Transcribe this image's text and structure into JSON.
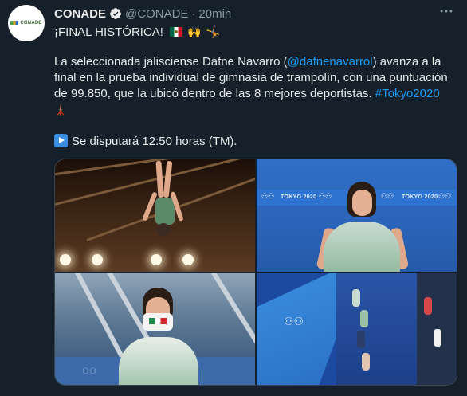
{
  "author": {
    "name": "CONADE",
    "handle": "@CONADE",
    "separator": "·",
    "time": "20min",
    "avatar_text": "CONADE",
    "verified": true
  },
  "tweet": {
    "line1": "¡FINAL HISTÓRICA!",
    "para_before_mention": "La seleccionada jalisciense Dafne Navarro (",
    "mention": "@dafnenavarrol",
    "para_after_mention": ") avanza a la final en la prueba individual de gimnasia de trampolín, con una puntuación de 99.850, que la ubicó dentro de las 8 mejores deportistas. ",
    "hashtag": "#Tokyo2020",
    "schedule": "Se disputará 12:50 horas (TM)."
  },
  "icons": {
    "verified": "verified-badge-icon",
    "more": "more-options-icon",
    "flag": "mexico-flag-emoji",
    "hands": "raised-hands-emoji",
    "gym": "gymnast-emoji",
    "tower": "tokyo-tower-emoji",
    "play": "play-button-emoji"
  },
  "media": {
    "backdrop_text": "TOKYO 2020",
    "olympic_rings": "⚇⚇"
  },
  "colors": {
    "background": "#15202b",
    "text": "#e7e9ea",
    "muted": "#8b98a5",
    "link": "#1d9bf0"
  }
}
